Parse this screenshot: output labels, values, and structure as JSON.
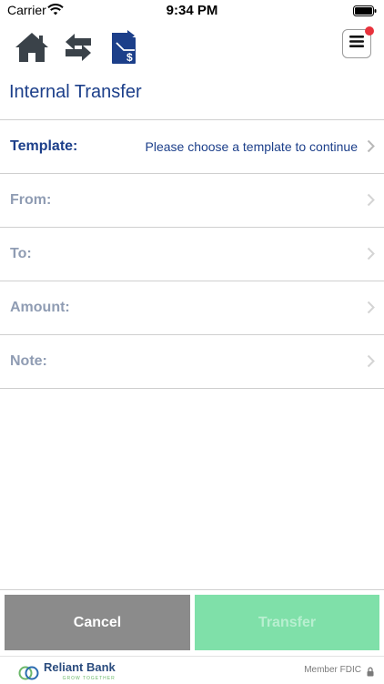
{
  "status_bar": {
    "carrier": "Carrier",
    "time": "9:34 PM",
    "icons": [
      "wifi-icon",
      "battery-icon"
    ]
  },
  "toolbar": {
    "icons": [
      "home-icon",
      "transfer-arrows-icon",
      "transfer-money-icon",
      "menu-icon"
    ],
    "notification_dot_color": "#e8323c"
  },
  "page": {
    "title": "Internal Transfer"
  },
  "form": {
    "rows": [
      {
        "label": "Template:",
        "value": "Please choose a template to continue"
      },
      {
        "label": "From:",
        "value": ""
      },
      {
        "label": "To:",
        "value": ""
      },
      {
        "label": "Amount:",
        "value": ""
      },
      {
        "label": "Note:",
        "value": ""
      }
    ]
  },
  "actions": {
    "cancel_label": "Cancel",
    "transfer_label": "Transfer"
  },
  "footer": {
    "brand": "Reliant Bank",
    "tagline": "GROW TOGETHER",
    "fdic": "Member FDIC"
  },
  "colors": {
    "brand_blue": "#1c3f8a",
    "disabled_label": "#8f9cb3",
    "cancel_bg": "#8b8b8b",
    "transfer_bg": "#7fe0a9"
  }
}
